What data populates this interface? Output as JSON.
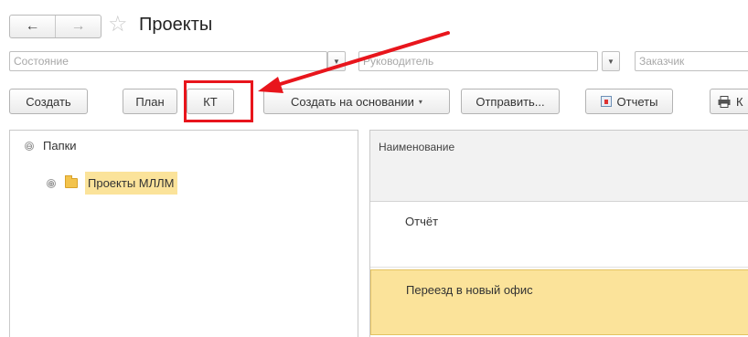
{
  "header": {
    "back_icon": "←",
    "forward_icon": "→",
    "favorite_icon": "☆",
    "title": "Проекты"
  },
  "filters": {
    "state_placeholder": "Состояние",
    "manager_placeholder": "Руководитель",
    "customer_placeholder": "Заказчик",
    "dropdown_glyph": "▼"
  },
  "toolbar": {
    "create_label": "Создать",
    "plan_label": "План",
    "kt_label": "КТ",
    "create_based_label": "Создать на основании",
    "create_based_caret": "▾",
    "send_label": "Отправить...",
    "reports_label": "Отчеты",
    "print_label": "К"
  },
  "tree": {
    "root_toggle": "⊖",
    "root_label": "Папки",
    "child_toggle": "⊕",
    "child_label": "Проекты МЛЛМ"
  },
  "list": {
    "column_header": "Наименование",
    "rows": [
      {
        "name": "Отчёт"
      },
      {
        "name": "Переезд в новый офис"
      }
    ]
  },
  "annotation": {
    "color": "#e8151c"
  }
}
